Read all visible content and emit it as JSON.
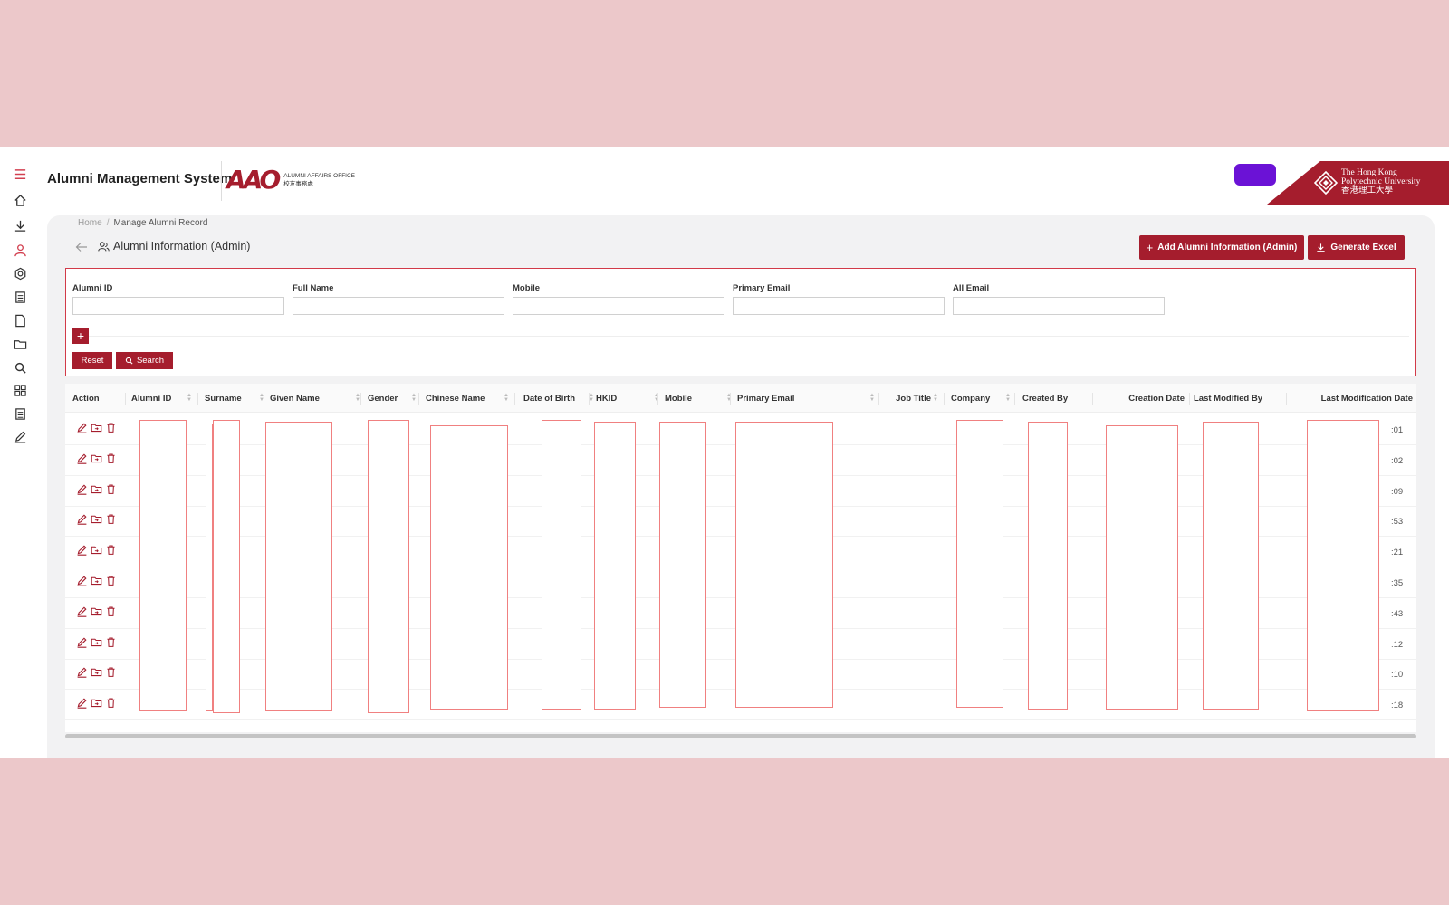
{
  "header": {
    "app_title": "Alumni Management System",
    "aao_mark": "AAO",
    "aao_en": "ALUMNI AFFAIRS OFFICE",
    "aao_zh": "校友事務處",
    "polyu_line1": "The Hong Kong",
    "polyu_line2": "Polytechnic University",
    "polyu_zh": "香港理工大學"
  },
  "breadcrumb": {
    "home": "Home",
    "separator": "/",
    "current": "Manage Alumni Record"
  },
  "page": {
    "title": "Alumni Information (Admin)",
    "add_button": "Add Alumni Information (Admin)",
    "excel_button": "Generate Excel"
  },
  "filters": {
    "fields": [
      {
        "label": "Alumni ID"
      },
      {
        "label": "Full Name"
      },
      {
        "label": "Mobile"
      },
      {
        "label": "Primary Email"
      },
      {
        "label": "All Email"
      }
    ],
    "plus_label": "+",
    "reset_label": "Reset",
    "search_label": "Search"
  },
  "table": {
    "columns": [
      "Action",
      "Alumni ID",
      "Surname",
      "Given Name",
      "Gender",
      "Chinese Name",
      "Date of Birth",
      "HKID",
      "Mobile",
      "Primary Email",
      "Job Title",
      "Company",
      "Created By",
      "Creation Date",
      "Last Modified By",
      "Last Modification Date"
    ],
    "row_suffixes": [
      ":01",
      ":02",
      ":09",
      ":53",
      ":21",
      ":35",
      ":43",
      ":12",
      ":10",
      ":18"
    ]
  },
  "sidebar": {
    "icons": [
      "menu-icon",
      "home-icon",
      "download-icon",
      "user-icon",
      "settings-icon",
      "list-icon",
      "document-icon",
      "folder-icon",
      "search-icon",
      "grid-icon",
      "list-icon",
      "edit-icon"
    ]
  },
  "colors": {
    "brand": "#a51d2d",
    "accent_user": "#6b12d6",
    "backdrop": "#ecc8ca",
    "redact_border": "#f08080"
  }
}
